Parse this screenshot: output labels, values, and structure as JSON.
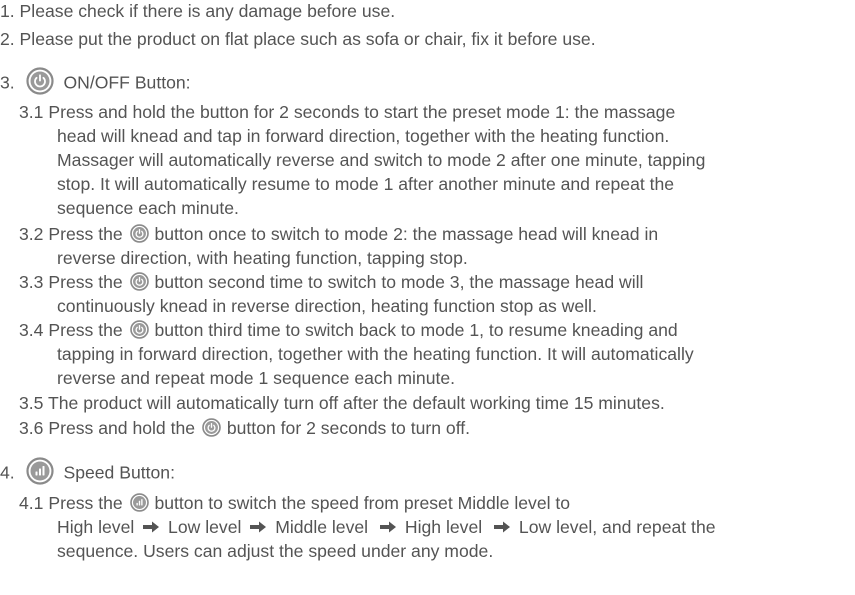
{
  "items": {
    "i1": "1. Please check if there is any damage before use.",
    "i2": "2. Please put the product on flat place such as sofa or chair, fix it before use.",
    "i3_num": "3.",
    "i3_title": "ON/OFF Button:",
    "s31": [
      "3.1 Press and hold the button for 2 seconds to start the preset mode 1: the massage",
      "head will knead and tap in forward direction, together with the heating function.",
      "Massager will automatically reverse and switch to mode 2 after one minute, tapping",
      "stop. It will automatically resume to mode 1 after another minute and repeat the",
      "sequence each minute."
    ],
    "s32_a": "3.2 Press the",
    "s32_b": "button once to switch to mode 2: the massage head will knead in",
    "s32_c": "reverse direction, with heating function, tapping stop.",
    "s33_a": "3.3 Press the",
    "s33_b": "button second time to switch to mode 3, the massage head will",
    "s33_c": "continuously knead in reverse direction, heating function stop as well.",
    "s34_a": "3.4 Press the",
    "s34_b": "button third time to switch back to mode 1, to resume kneading and",
    "s34_c": "tapping in forward direction, together with the heating function. It will automatically",
    "s34_d": "reverse and repeat mode 1 sequence each minute.",
    "s35": "3.5 The product will automatically turn off after the default working time 15 minutes.",
    "s36_a": "3.6 Press and hold the",
    "s36_b": "button for 2 seconds to turn off.",
    "i4_num": "4.",
    "i4_title": "Speed Button:",
    "s41_a": "4.1 Press the",
    "s41_b": "button to switch the speed from preset Middle level to",
    "s41_c_hi1": "High level",
    "s41_c_lo1": "Low level",
    "s41_c_mid": "Middle level",
    "s41_c_hi2": "High level",
    "s41_c_lo2": "Low level, and repeat the",
    "s41_d": "sequence. Users can adjust the speed under any mode."
  },
  "colors": {
    "text": "#545454",
    "icon_ring": "#8a8a8a",
    "icon_fill": "#9a9a9a"
  },
  "icons": {
    "power": "power-icon",
    "speed": "speed-icon",
    "arrow": "arrow-right-icon"
  }
}
